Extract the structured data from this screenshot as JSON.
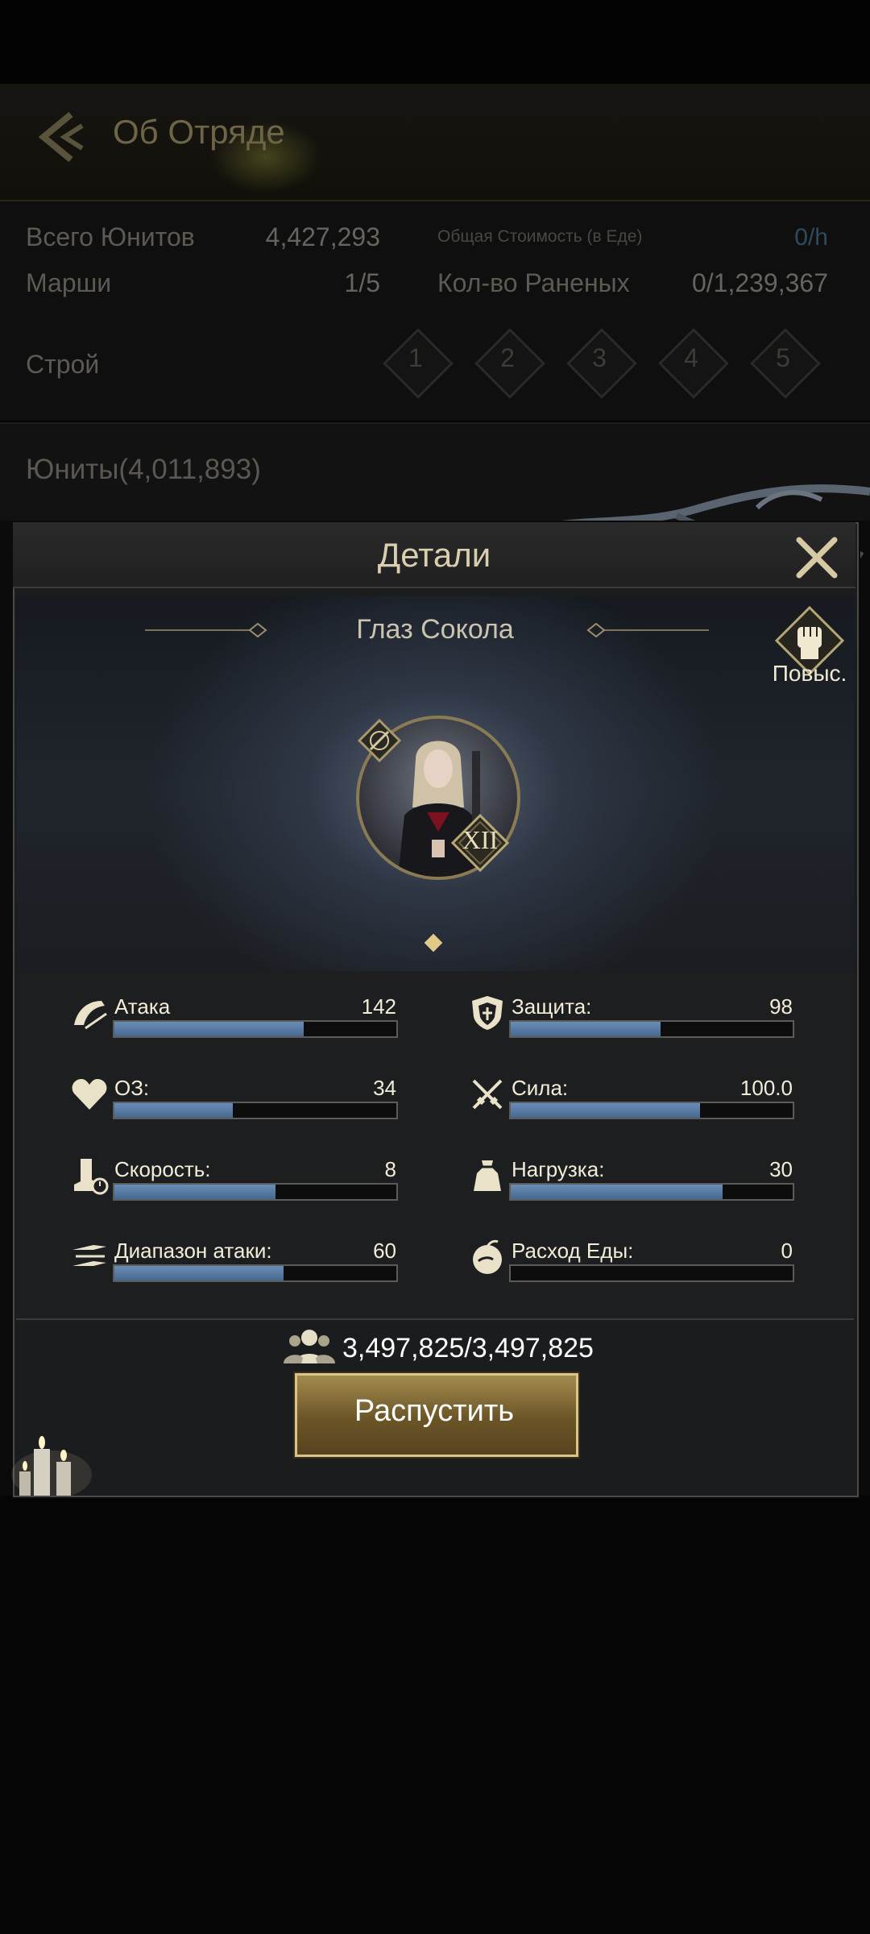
{
  "header": {
    "title": "Об Отряде"
  },
  "summary": {
    "total_units_label": "Всего Юнитов",
    "total_units_value": "4,427,293",
    "marches_label": "Марши",
    "marches_value": "1/5",
    "food_cost_label": "Общая Стоимость (в Еде)",
    "food_cost_value": "0/h",
    "wounded_label": "Кол-во Раненых",
    "wounded_value": "0/1,239,367",
    "formation_label": "Строй",
    "formations": [
      "1",
      "2",
      "3",
      "4",
      "5"
    ]
  },
  "units": {
    "label": "Юниты(4,011,893)"
  },
  "modal": {
    "title": "Детали",
    "unit_name": "Глаз Сокола",
    "upgrade_label": "Повыс.",
    "rank": "XII",
    "stats": [
      {
        "icon": "attack-icon",
        "label": "Атака",
        "value": "142",
        "fill": 0.67
      },
      {
        "icon": "defense-icon",
        "label": "Защита:",
        "value": "98",
        "fill": 0.53
      },
      {
        "icon": "health-icon",
        "label": "ОЗ:",
        "value": "34",
        "fill": 0.42
      },
      {
        "icon": "power-icon",
        "label": "Сила:",
        "value": "100.0",
        "fill": 0.67
      },
      {
        "icon": "speed-icon",
        "label": "Скорость:",
        "value": "8",
        "fill": 0.57
      },
      {
        "icon": "load-icon",
        "label": "Нагрузка:",
        "value": "30",
        "fill": 0.75
      },
      {
        "icon": "range-icon",
        "label": "Диапазон атаки:",
        "value": "60",
        "fill": 0.6
      },
      {
        "icon": "food-icon",
        "label": "Расход Еды:",
        "value": "0",
        "fill": 0
      }
    ],
    "troop_count": "3,497,825/3,497,825",
    "dismiss_label": "Распустить"
  },
  "colors": {
    "accent_gold": "#d9c58b",
    "bar_blue": "#5a7ea8"
  }
}
